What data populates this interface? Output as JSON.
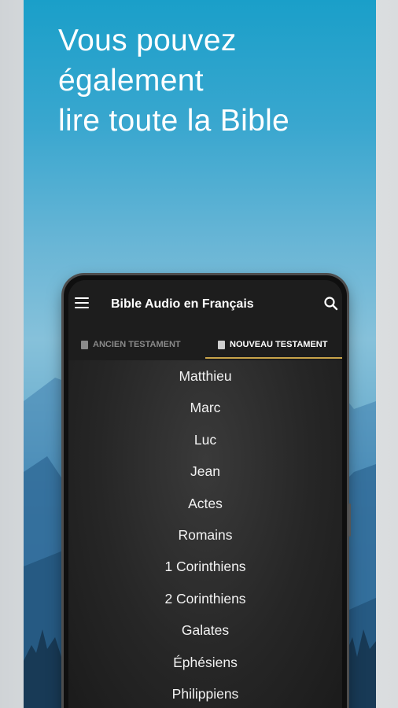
{
  "headline": {
    "line1": "Vous pouvez",
    "line2": "également",
    "line3": "lire toute la Bible"
  },
  "app": {
    "title": "Bible Audio en Français",
    "menu_icon": "menu-icon",
    "search_icon": "search-icon"
  },
  "tabs": [
    {
      "label": "ANCIEN TESTAMENT",
      "icon": "book-icon",
      "active": false
    },
    {
      "label": "NOUVEAU TESTAMENT",
      "icon": "book-icon",
      "active": true
    }
  ],
  "books": [
    "Matthieu",
    "Marc",
    "Luc",
    "Jean",
    "Actes",
    "Romains",
    "1 Corinthiens",
    "2 Corinthiens",
    "Galates",
    "Éphésiens",
    "Philippiens"
  ],
  "colors": {
    "sky_top": "#1a9fc9",
    "tab_indicator": "#c9a44a",
    "appbar": "#1d1d1d"
  }
}
